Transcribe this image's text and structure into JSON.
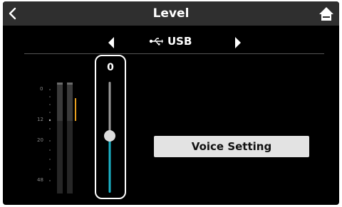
{
  "header": {
    "title": "Level",
    "back_icon": "chevron-left-icon",
    "home_icon": "home-icon"
  },
  "source": {
    "label": "USB",
    "icon": "usb-icon"
  },
  "meter": {
    "scale_labels": [
      "0",
      "12",
      "20",
      "48"
    ],
    "peak_color": "#e8a020"
  },
  "fader": {
    "value": "0",
    "level_fraction": 0.55,
    "accent_color": "#1bb3c7"
  },
  "buttons": {
    "voice_setting": "Voice Setting"
  }
}
